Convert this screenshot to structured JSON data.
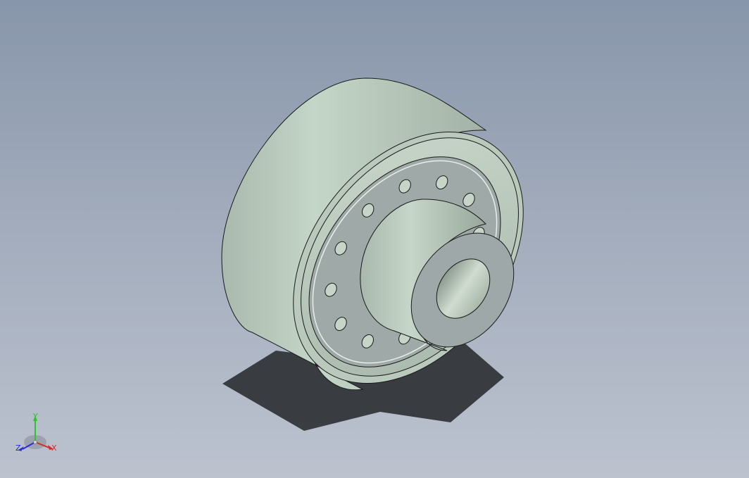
{
  "viewport": {
    "background_top": "#8896ab",
    "background_bottom": "#bcc3cf"
  },
  "model": {
    "part_color": "#c2d2c4",
    "face_color": "#9ca6a6",
    "bolt_hole_count": 12,
    "edge_color": "#1a1a1a"
  },
  "triad": {
    "x_label": "X",
    "y_label": "Y",
    "z_label": "Z",
    "x_color": "#d42a2a",
    "y_color": "#2cc42c",
    "z_color": "#2a2ad4"
  }
}
